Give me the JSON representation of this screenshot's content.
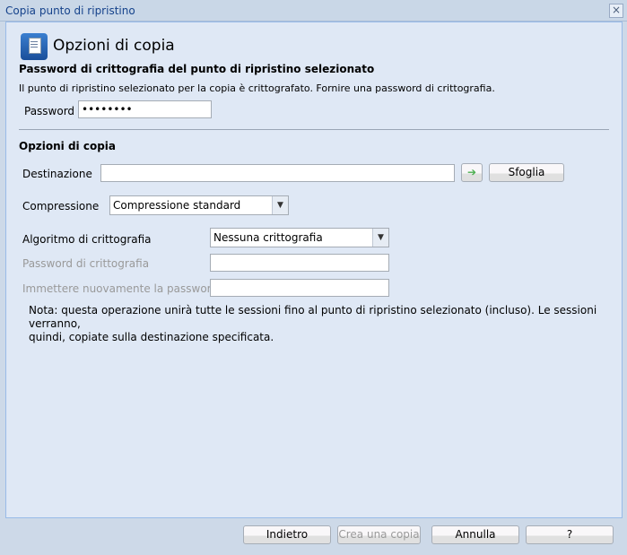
{
  "window": {
    "title": "Copia punto di ripristino",
    "close": "×"
  },
  "header": {
    "title": "Opzioni di copia"
  },
  "password_section": {
    "heading": "Password di crittografia del punto di ripristino selezionato",
    "description": "Il punto di ripristino selezionato per la copia è crittografato. Fornire una password di crittografia.",
    "password_label": "Password",
    "password_value": "••••••••"
  },
  "copy_options": {
    "heading": "Opzioni di copia",
    "destination_label": "Destinazione",
    "destination_value": "",
    "browse_label": "Sfoglia",
    "compression_label": "Compressione",
    "compression_value": "Compressione standard",
    "encryption_algorithm_label": "Algoritmo di crittografia",
    "encryption_algorithm_value": "Nessuna crittografia",
    "encryption_password_label": "Password di crittografia",
    "reenter_password_label": "Immettere nuovamente la password",
    "note": "Nota: questa operazione unirà tutte le sessioni fino al punto di ripristino selezionato (incluso). Le sessioni verranno,\nquindi, copiate sulla destinazione specificata."
  },
  "footer": {
    "back": "Indietro",
    "create_copy": "Crea una copia",
    "cancel": "Annulla",
    "help": "?"
  }
}
